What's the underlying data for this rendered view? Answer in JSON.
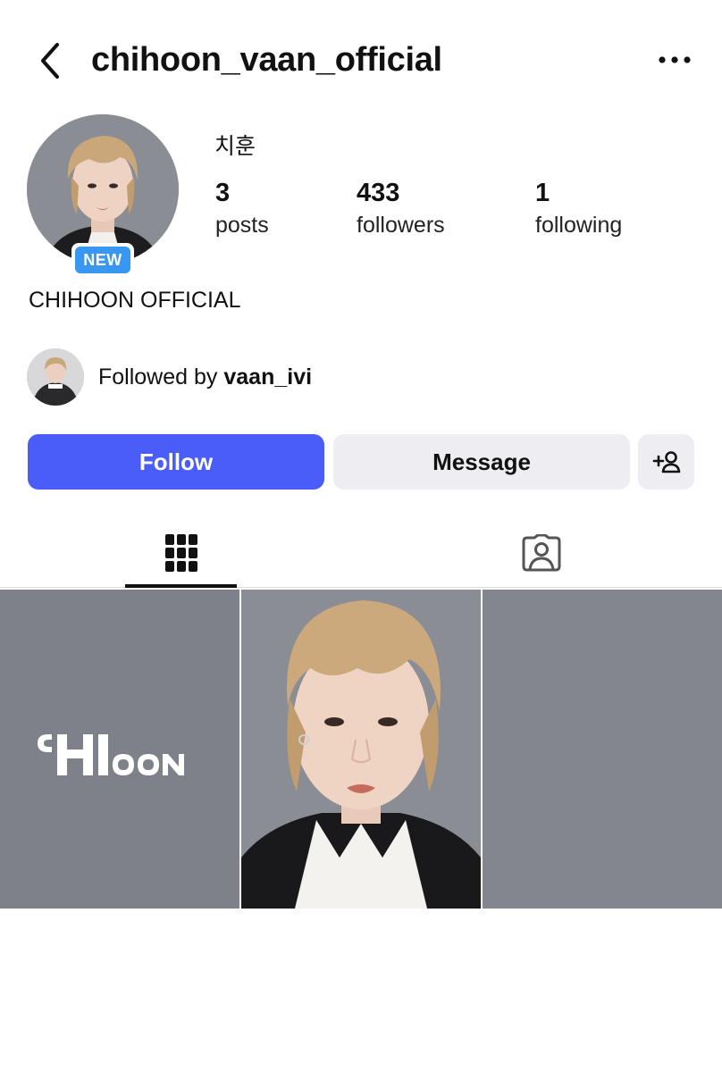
{
  "header": {
    "back_icon": "chevron-left-icon",
    "username": "chihoon_vaan_official",
    "more_icon": "more-horizontal-icon"
  },
  "profile": {
    "avatar": "profile-photo",
    "new_badge": "NEW",
    "display_name": "치훈",
    "stats": [
      {
        "value": "3",
        "label": "posts"
      },
      {
        "value": "433",
        "label": "followers"
      },
      {
        "value": "1",
        "label": "following"
      }
    ],
    "bio": "CHIHOON OFFICIAL",
    "followed_by_prefix": "Followed by",
    "followed_by_user": "vaan_ivi"
  },
  "actions": {
    "follow": "Follow",
    "message": "Message",
    "add_user_icon": "add-person-icon"
  },
  "tabs": [
    {
      "icon": "grid-icon",
      "active": true
    },
    {
      "icon": "tagged-person-icon",
      "active": false
    }
  ],
  "posts": [
    {
      "type": "logo",
      "logo_text": "CHIHOON"
    },
    {
      "type": "photo"
    },
    {
      "type": "photo"
    }
  ],
  "colors": {
    "follow_button": "#4a5df9",
    "secondary_button": "#eeeef2",
    "new_badge": "#3897f0"
  }
}
